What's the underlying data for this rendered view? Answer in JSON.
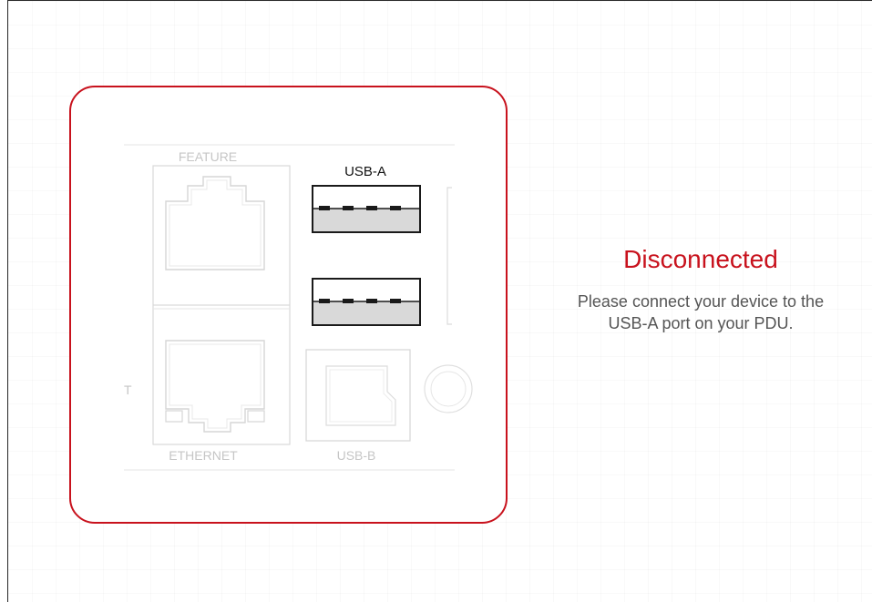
{
  "device_diagram": {
    "port_labels": {
      "feature": "FEATURE",
      "usb_a": "USB-A",
      "ethernet": "ETHERNET",
      "usb_b": "USB-B",
      "partial_left": "T"
    }
  },
  "status": {
    "title": "Disconnected",
    "message_line1": "Please connect your device to the",
    "message_line2": "USB-A port on your PDU."
  },
  "colors": {
    "accent": "#c8121d",
    "message_text": "#555555",
    "faded_outline": "#d6d6d6"
  }
}
